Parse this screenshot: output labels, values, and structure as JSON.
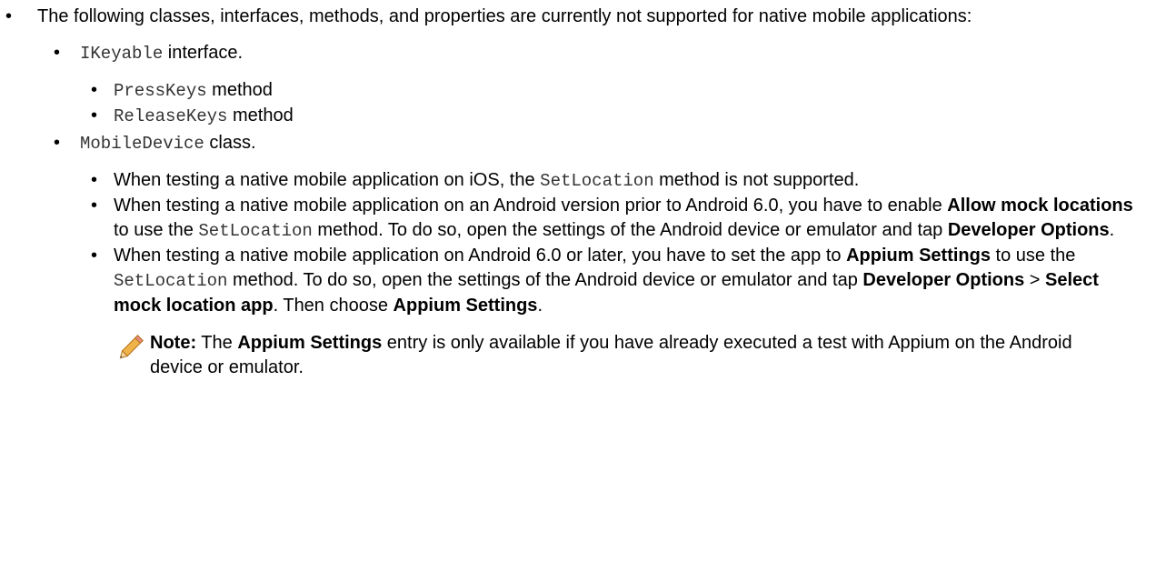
{
  "intro": {
    "text": "The following classes, interfaces, methods, and properties are currently not supported for native mobile applications:"
  },
  "ikeyable": {
    "code": "IKeyable",
    "suffix": " interface.",
    "methods": [
      {
        "code": "PressKeys",
        "suffix": " method"
      },
      {
        "code": "ReleaseKeys",
        "suffix": " method"
      }
    ]
  },
  "mobiledevice": {
    "code": "MobileDevice",
    "suffix": " class.",
    "item1": {
      "t1": "When testing a native mobile application on iOS, the ",
      "code": "SetLocation",
      "t2": " method is not supported."
    },
    "item2": {
      "t1": "When testing a native mobile application on an Android version prior to Android 6.0, you have to enable ",
      "b1": "Allow mock locations",
      "t2": " to use the ",
      "code": "SetLocation",
      "t3": " method. To do so, open the settings of the Android device or emulator and tap ",
      "b2": "Developer Options",
      "t4": "."
    },
    "item3": {
      "t1": "When testing a native mobile application on Android 6.0 or later, you have to set the app to ",
      "b1": "Appium Settings",
      "t2": " to use the ",
      "code": "SetLocation",
      "t3": " method. To do so, open the settings of the Android device or emulator and tap ",
      "b2": "Developer Options",
      "t4": " > ",
      "b3": "Select mock location app",
      "t5": ". Then choose ",
      "b4": "Appium Settings",
      "t6": "."
    },
    "note": {
      "label": "Note:",
      "t1": " The ",
      "b1": "Appium Settings",
      "t2": " entry is only available if you have already executed a test with Appium on the Android device or emulator.",
      "icon": "pencil-icon",
      "icon_color": "#e8a23a"
    }
  }
}
